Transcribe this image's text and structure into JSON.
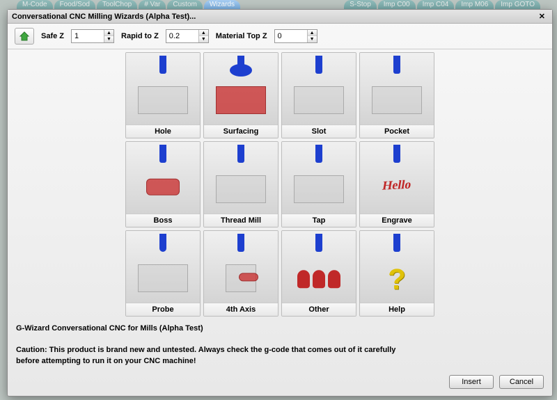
{
  "background_tabs_left": [
    "M-Code",
    "Food/Sod",
    "ToolChop",
    "# Var",
    "Custom",
    "Wizards"
  ],
  "background_tabs_right": [
    "S-Stop",
    "Imp C00",
    "Imp C04",
    "Imp M06",
    "Imp GOTO"
  ],
  "wizard_tab_index": 5,
  "window": {
    "title": "Conversational CNC Milling Wizards (Alpha Test)..."
  },
  "toolbar": {
    "home_icon": "home-icon",
    "safe_z_label": "Safe Z",
    "safe_z_value": "1",
    "rapid_to_z_label": "Rapid to Z",
    "rapid_to_z_value": "0.2",
    "material_top_z_label": "Material Top Z",
    "material_top_z_value": "0"
  },
  "tiles": [
    {
      "label": "Hole"
    },
    {
      "label": "Surfacing"
    },
    {
      "label": "Slot"
    },
    {
      "label": "Pocket"
    },
    {
      "label": "Boss"
    },
    {
      "label": "Thread Mill"
    },
    {
      "label": "Tap"
    },
    {
      "label": "Engrave"
    },
    {
      "label": "Probe"
    },
    {
      "label": "4th Axis"
    },
    {
      "label": "Other"
    },
    {
      "label": "Help"
    }
  ],
  "footer": {
    "line1": "G-Wizard Conversational CNC for Mills (Alpha Test)",
    "line2": "Caution: This product is brand new and untested.  Always check the g-code that comes out of it carefully",
    "line3": "before attempting to run it on your CNC machine!"
  },
  "buttons": {
    "insert": "Insert",
    "cancel": "Cancel"
  }
}
